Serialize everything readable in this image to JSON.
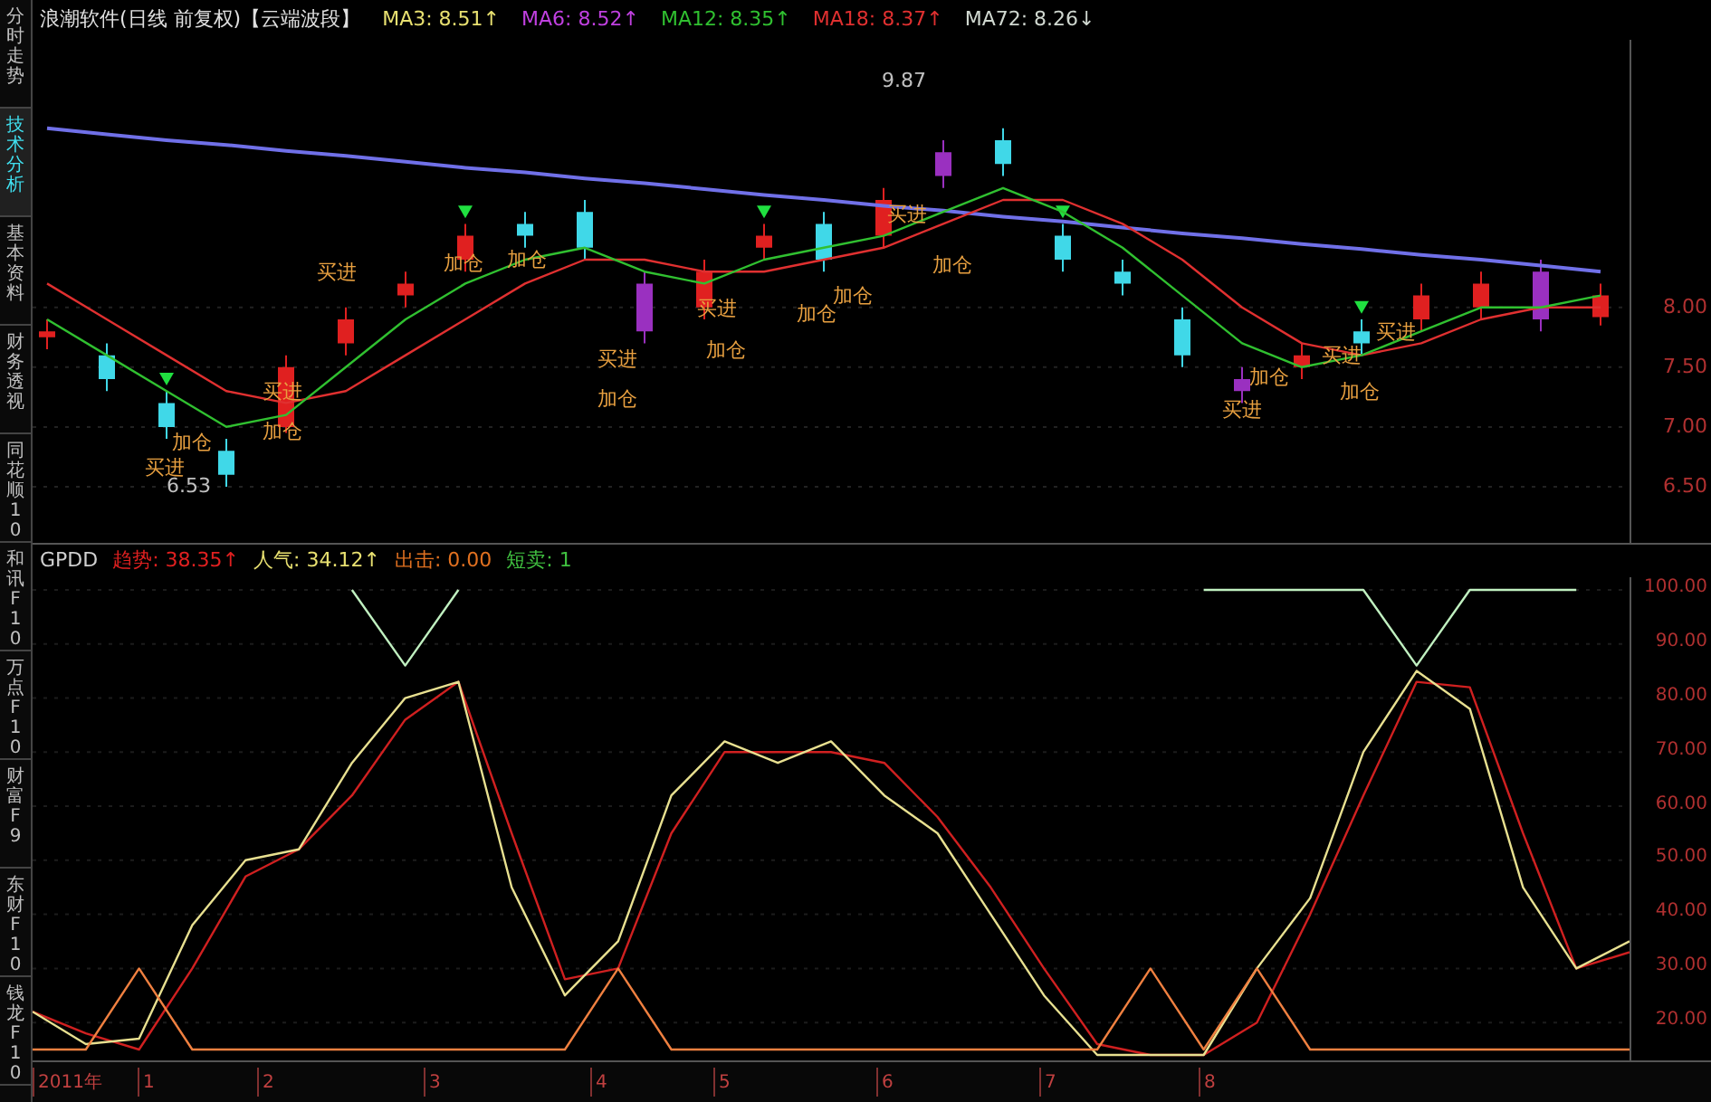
{
  "sidebar": {
    "tabs": [
      {
        "label": "分时走势",
        "selected": false
      },
      {
        "label": "技术分析",
        "selected": true
      },
      {
        "label": "基本资料",
        "selected": false
      },
      {
        "label": "财务透视",
        "selected": false
      },
      {
        "label": "同花顺10",
        "selected": false
      },
      {
        "label": "和讯F10",
        "selected": false
      },
      {
        "label": "万点F10",
        "selected": false
      },
      {
        "label": "财富F9",
        "selected": false
      },
      {
        "label": "东财F10",
        "selected": false
      },
      {
        "label": "钱龙F10",
        "selected": false
      }
    ]
  },
  "price_panel": {
    "title": "浪潮软件(日线 前复权)【云端波段】",
    "indicators": [
      {
        "text": "MA3: 8.51↑",
        "color": "#e8e070"
      },
      {
        "text": "MA6: 8.52↑",
        "color": "#c040e0"
      },
      {
        "text": "MA12: 8.35↑",
        "color": "#30c030"
      },
      {
        "text": "MA18: 8.37↑",
        "color": "#e03030"
      },
      {
        "text": "MA72: 8.26↓",
        "color": "#d0d8d0"
      }
    ],
    "chart_labels": [
      {
        "text": "加仓"
      },
      {
        "text": "买进"
      },
      {
        "text": "6.53"
      },
      {
        "text": "买进"
      },
      {
        "text": "加仓"
      },
      {
        "text": "买进"
      },
      {
        "text": "加仓"
      },
      {
        "text": "加仓"
      },
      {
        "text": "买进"
      },
      {
        "text": "加仓"
      },
      {
        "text": "买进"
      },
      {
        "text": "加仓"
      },
      {
        "text": "加仓"
      },
      {
        "text": "加仓"
      },
      {
        "text": "加仓"
      },
      {
        "text": "买进"
      },
      {
        "text": "9.87"
      },
      {
        "text": "加仓"
      },
      {
        "text": "买进"
      },
      {
        "text": "买进"
      },
      {
        "text": "加仓"
      },
      {
        "text": "买进"
      }
    ],
    "chart_data": {
      "type": "candlestick",
      "ylim": [
        6.03,
        10.24
      ],
      "grid": true,
      "yticks": [
        {
          "value": 8,
          "label": "8.00"
        },
        {
          "value": 7.5,
          "label": "7.50"
        },
        {
          "value": 7,
          "label": "7.00"
        },
        {
          "value": 6.5,
          "label": "6.50"
        }
      ],
      "ohlc": [
        [
          7.75,
          7.9,
          7.65,
          7.8
        ],
        [
          7.6,
          7.7,
          7.3,
          7.4
        ],
        [
          7.2,
          7.3,
          6.9,
          7.0
        ],
        [
          6.8,
          6.9,
          6.5,
          6.6
        ],
        [
          7.0,
          7.6,
          6.95,
          7.5
        ],
        [
          7.7,
          8.0,
          7.6,
          7.9
        ],
        [
          8.1,
          8.3,
          8.0,
          8.2
        ],
        [
          8.4,
          8.7,
          8.3,
          8.6
        ],
        [
          8.7,
          8.8,
          8.5,
          8.6
        ],
        [
          8.8,
          8.9,
          8.4,
          8.5
        ],
        [
          8.2,
          8.3,
          7.7,
          7.8
        ],
        [
          8.0,
          8.4,
          7.9,
          8.3
        ],
        [
          8.5,
          8.7,
          8.4,
          8.6
        ],
        [
          8.7,
          8.8,
          8.3,
          8.4
        ],
        [
          8.6,
          9.0,
          8.5,
          8.9
        ],
        [
          9.3,
          9.4,
          9.0,
          9.1
        ],
        [
          9.4,
          9.5,
          9.1,
          9.2
        ],
        [
          8.6,
          8.7,
          8.3,
          8.4
        ],
        [
          8.3,
          8.4,
          8.1,
          8.2
        ],
        [
          7.9,
          8.0,
          7.5,
          7.6
        ],
        [
          7.4,
          7.5,
          7.2,
          7.3
        ],
        [
          7.5,
          7.7,
          7.4,
          7.6
        ],
        [
          7.8,
          7.9,
          7.6,
          7.7
        ],
        [
          7.9,
          8.2,
          7.8,
          8.1
        ],
        [
          8.0,
          8.3,
          7.9,
          8.2
        ],
        [
          8.3,
          8.4,
          7.8,
          7.9
        ],
        [
          7.92,
          8.2,
          7.85,
          8.1
        ]
      ],
      "series": [
        {
          "type": "line",
          "color": "#7070e8",
          "values": [
            9.5,
            9.45,
            9.4,
            9.36,
            9.31,
            9.27,
            9.22,
            9.17,
            9.13,
            9.08,
            9.04,
            8.99,
            8.94,
            8.9,
            8.85,
            8.81,
            8.76,
            8.72,
            8.67,
            8.62,
            8.58,
            8.53,
            8.49,
            8.44,
            8.4,
            8.35,
            8.3
          ]
        },
        {
          "type": "line",
          "color": "#e03030",
          "values": [
            8.2,
            7.9,
            7.6,
            7.3,
            7.2,
            7.3,
            7.6,
            7.9,
            8.2,
            8.4,
            8.4,
            8.3,
            8.3,
            8.4,
            8.5,
            8.7,
            8.9,
            8.9,
            8.7,
            8.4,
            8.0,
            7.7,
            7.6,
            7.7,
            7.9,
            8.0,
            8.0
          ]
        },
        {
          "type": "line",
          "color": "#30c030",
          "values": [
            7.9,
            7.6,
            7.3,
            7.0,
            7.1,
            7.5,
            7.9,
            8.2,
            8.4,
            8.5,
            8.3,
            8.2,
            8.4,
            8.5,
            8.6,
            8.8,
            9.0,
            8.8,
            8.5,
            8.1,
            7.7,
            7.5,
            7.6,
            7.8,
            8.0,
            8.0,
            8.1
          ]
        },
        {
          "type": "scatter",
          "color": "#20e040",
          "values": [
            null,
            null,
            7.4,
            null,
            null,
            null,
            null,
            8.8,
            null,
            null,
            null,
            null,
            8.8,
            null,
            null,
            null,
            null,
            8.8,
            null,
            null,
            null,
            null,
            8.0,
            null,
            null,
            null,
            null
          ]
        }
      ]
    }
  },
  "indicator_panel": {
    "name": "GPDD",
    "values": [
      {
        "text": "趋势: 38.35↑",
        "color": "#e02020"
      },
      {
        "text": "人气: 34.12↑",
        "color": "#e8e070"
      },
      {
        "text": "出击: 0.00",
        "color": "#e07020"
      },
      {
        "text": "短卖: 1",
        "color": "#40c040"
      }
    ],
    "chart_data": {
      "type": "line",
      "ylim": [
        13,
        102
      ],
      "grid": true,
      "yticks": [
        {
          "value": 100,
          "label": "100.00"
        },
        {
          "value": 90,
          "label": "90.00"
        },
        {
          "value": 80,
          "label": "80.00"
        },
        {
          "value": 70,
          "label": "70.00"
        },
        {
          "value": 60,
          "label": "60.00"
        },
        {
          "value": 50,
          "label": "50.00"
        },
        {
          "value": 40,
          "label": "40.00"
        },
        {
          "value": 30,
          "label": "30.00"
        },
        {
          "value": 20,
          "label": "20.00"
        }
      ],
      "series": [
        {
          "color": "#d02020",
          "values": [
            22,
            18,
            15,
            30,
            47,
            52,
            62,
            76,
            83,
            55,
            28,
            30,
            55,
            70,
            70,
            70,
            68,
            58,
            45,
            30,
            16,
            14,
            14,
            20,
            40,
            62,
            83,
            82,
            55,
            30,
            33
          ]
        },
        {
          "color": "#e8e090",
          "values": [
            22,
            16,
            17,
            38,
            50,
            52,
            68,
            80,
            83,
            45,
            25,
            35,
            62,
            72,
            68,
            72,
            62,
            55,
            40,
            25,
            14,
            14,
            14,
            30,
            43,
            70,
            85,
            78,
            45,
            30,
            35
          ]
        },
        {
          "color": "#c0f0c0",
          "values": [
            null,
            null,
            null,
            null,
            null,
            null,
            100,
            86,
            100,
            null,
            null,
            null,
            null,
            null,
            null,
            null,
            null,
            null,
            null,
            null,
            null,
            null,
            100,
            100,
            100,
            100,
            86,
            100,
            100,
            100,
            null
          ]
        },
        {
          "color": "#f08040",
          "values": [
            15,
            15,
            30,
            15,
            15,
            15,
            15,
            15,
            15,
            15,
            15,
            30,
            15,
            15,
            15,
            15,
            15,
            15,
            15,
            15,
            15,
            30,
            15,
            30,
            15,
            15,
            15,
            15,
            15,
            15,
            15
          ]
        }
      ]
    }
  },
  "time_axis": [
    "2011年",
    "1",
    "2",
    "3",
    "4",
    "5",
    "6",
    "7",
    "8"
  ]
}
